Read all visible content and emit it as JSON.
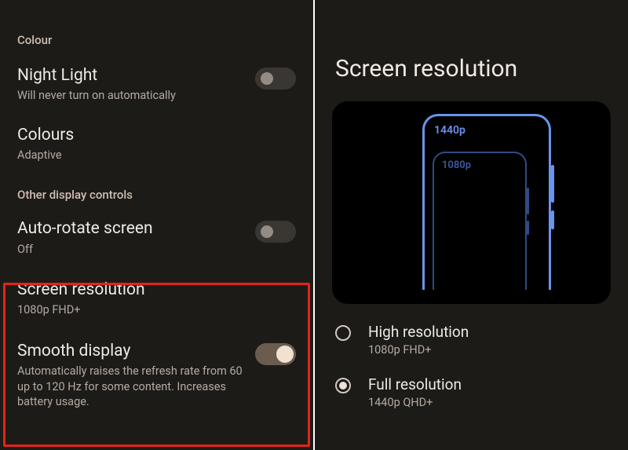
{
  "left": {
    "section_colour_header": "Colour",
    "section_other_header": "Other display controls",
    "night_light": {
      "title": "Night Light",
      "subtitle": "Will never turn on automatically",
      "on": false
    },
    "colours": {
      "title": "Colours",
      "subtitle": "Adaptive"
    },
    "auto_rotate": {
      "title": "Auto-rotate screen",
      "subtitle": "Off",
      "on": false
    },
    "screen_resolution": {
      "title": "Screen resolution",
      "subtitle": "1080p FHD+"
    },
    "smooth_display": {
      "title": "Smooth display",
      "subtitle": "Automatically raises the refresh rate from 60 up to 120 Hz for some content. Increases battery usage.",
      "on": true
    }
  },
  "right": {
    "page_title": "Screen resolution",
    "illustration": {
      "outer_label": "1440p",
      "inner_label": "1080p"
    },
    "options": [
      {
        "title": "High resolution",
        "subtitle": "1080p FHD+",
        "selected": false
      },
      {
        "title": "Full resolution",
        "subtitle": "1440p QHD+",
        "selected": true
      }
    ]
  }
}
